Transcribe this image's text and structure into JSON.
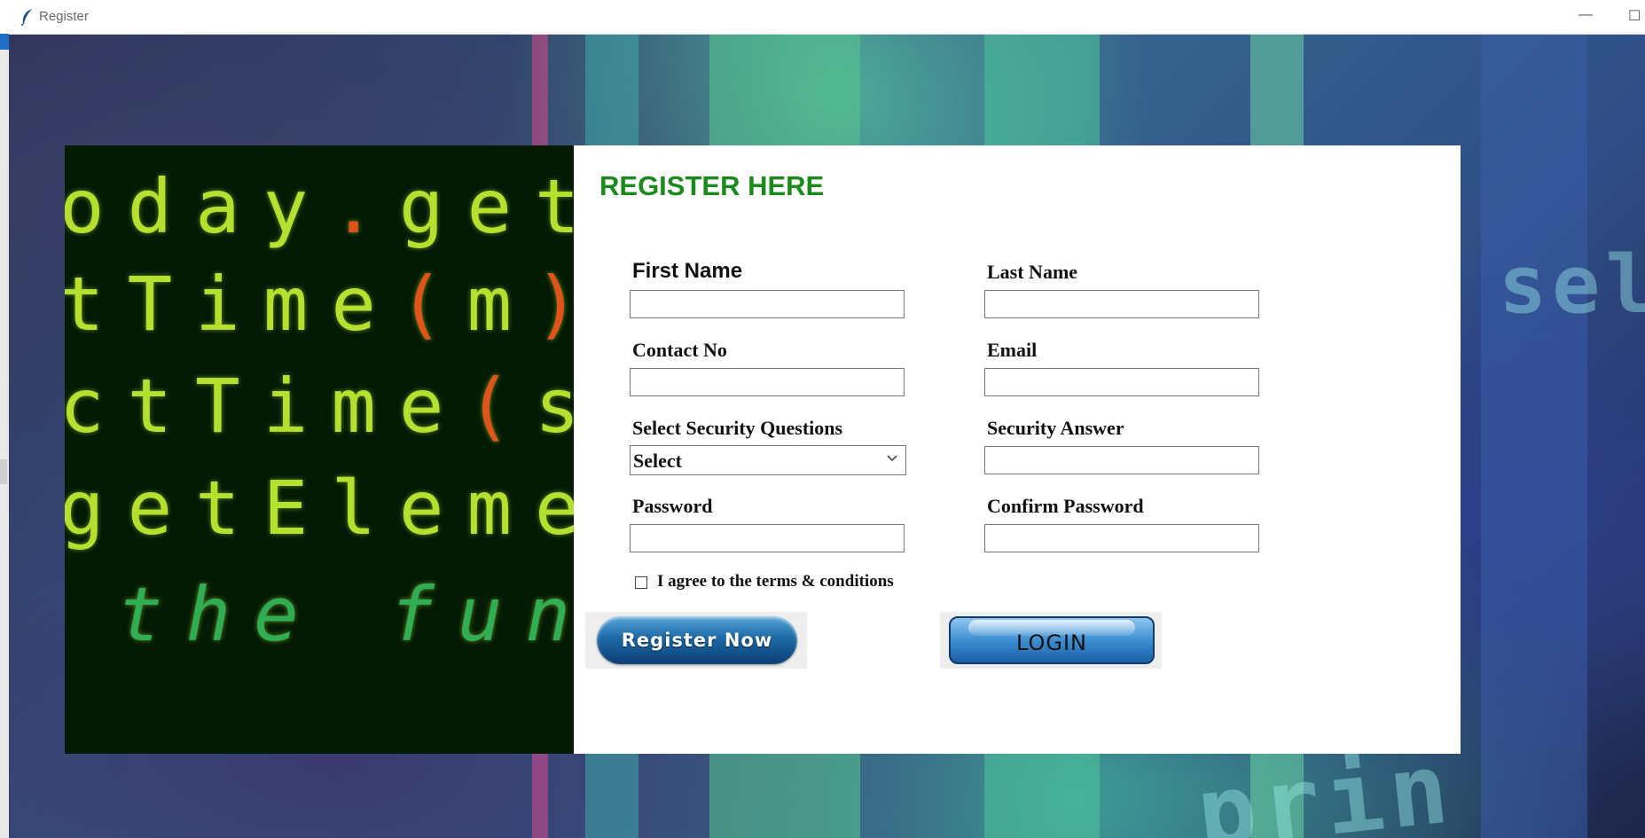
{
  "window": {
    "title": "Register",
    "icon": "feather-icon",
    "minimize_glyph": "—",
    "maximize_glyph": "☐"
  },
  "background": {
    "left_image_lines": [
      {
        "text": "oday.getSe"
      },
      {
        "text": "tTime(m);"
      },
      {
        "text": "ctTime(s);"
      },
      {
        "text": "getElement"
      },
      {
        "text": "the func"
      }
    ]
  },
  "form": {
    "heading": "REGISTER HERE",
    "first_name_label": "First Name",
    "last_name_label": "Last Name",
    "contact_label": "Contact No",
    "email_label": "Email",
    "security_question_label": "Select Security Questions",
    "security_question_value": "Select",
    "security_answer_label": "Security Answer",
    "password_label": "Password",
    "confirm_password_label": "Confirm Password",
    "first_name_value": "",
    "last_name_value": "",
    "contact_value": "",
    "email_value": "",
    "security_answer_value": "",
    "password_value": "",
    "confirm_password_value": "",
    "agree_label": "I agree to the terms & conditions",
    "agree_checked": false
  },
  "buttons": {
    "register_label": "Register Now",
    "login_label": "LOGIN"
  },
  "colors": {
    "heading": "#1a8a1a",
    "button_blue": "#1c6aa8"
  }
}
